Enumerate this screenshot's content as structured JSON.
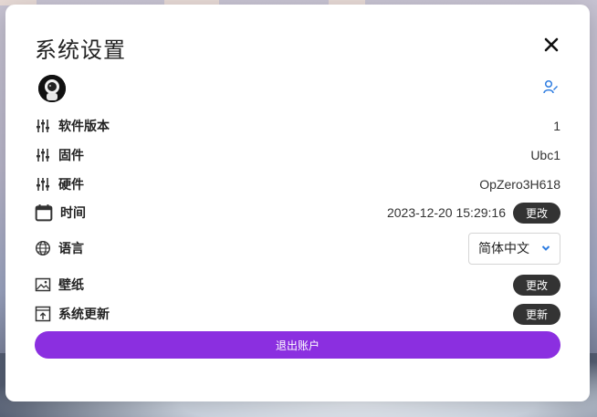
{
  "dialog": {
    "title": "系统设置",
    "close_icon": "close-icon",
    "user_icon": "user-switch-icon"
  },
  "rows": {
    "software_version": {
      "label": "软件版本",
      "value": "1",
      "icon": "sliders-icon"
    },
    "firmware": {
      "label": "固件",
      "value": "Ubc1",
      "icon": "sliders-icon"
    },
    "hardware": {
      "label": "硬件",
      "value": "OpZero3H618",
      "icon": "sliders-icon"
    },
    "time": {
      "label": "时间",
      "value": "2023-12-20 15:29:16",
      "button": "更改",
      "icon": "calendar-icon"
    },
    "language": {
      "label": "语言",
      "selected": "简体中文",
      "icon": "globe-icon"
    },
    "wallpaper": {
      "label": "壁纸",
      "button": "更改",
      "icon": "image-icon"
    },
    "system_update": {
      "label": "系统更新",
      "button": "更新",
      "icon": "upload-icon"
    }
  },
  "logout_label": "退出账户",
  "colors": {
    "accent": "#8b2fe0",
    "pill": "#333333",
    "link": "#2f7de1"
  }
}
